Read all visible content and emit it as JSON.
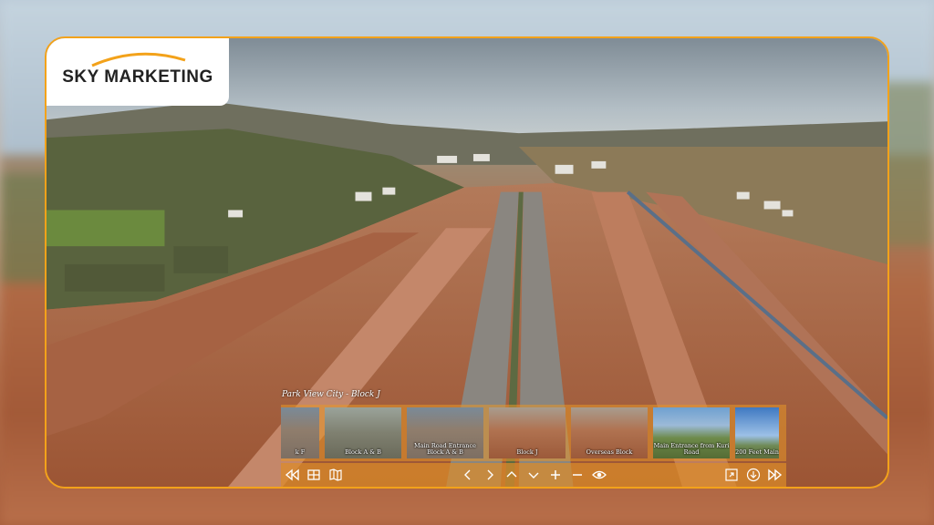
{
  "brand": {
    "name": "SKY MARKETING"
  },
  "tour": {
    "title": "Park View City - Block J",
    "thumbnails": [
      {
        "label": "k F",
        "scene": "road",
        "active": false
      },
      {
        "label": "Block A & B",
        "scene": "town",
        "active": false
      },
      {
        "label": "Main Road Entrance Block A & B",
        "scene": "road",
        "active": false
      },
      {
        "label": "Block J",
        "scene": "dirt",
        "active": true
      },
      {
        "label": "Overseas Block",
        "scene": "dirt",
        "active": false
      },
      {
        "label": "Main Entrance from Kuri Road",
        "scene": "field",
        "active": false
      },
      {
        "label": "200 Feet Main",
        "scene": "sky",
        "active": false
      }
    ]
  },
  "controls": [
    "rewind-icon",
    "grid-icon",
    "map-icon",
    "chevron-left-icon",
    "chevron-right-icon",
    "chevron-up-icon",
    "chevron-down-icon",
    "zoom-in-icon",
    "zoom-out-icon",
    "eye-icon",
    "fullscreen-icon",
    "download-icon",
    "fast-forward-icon"
  ],
  "colors": {
    "accent": "#f3a21a",
    "bar": "#dc8c28"
  }
}
